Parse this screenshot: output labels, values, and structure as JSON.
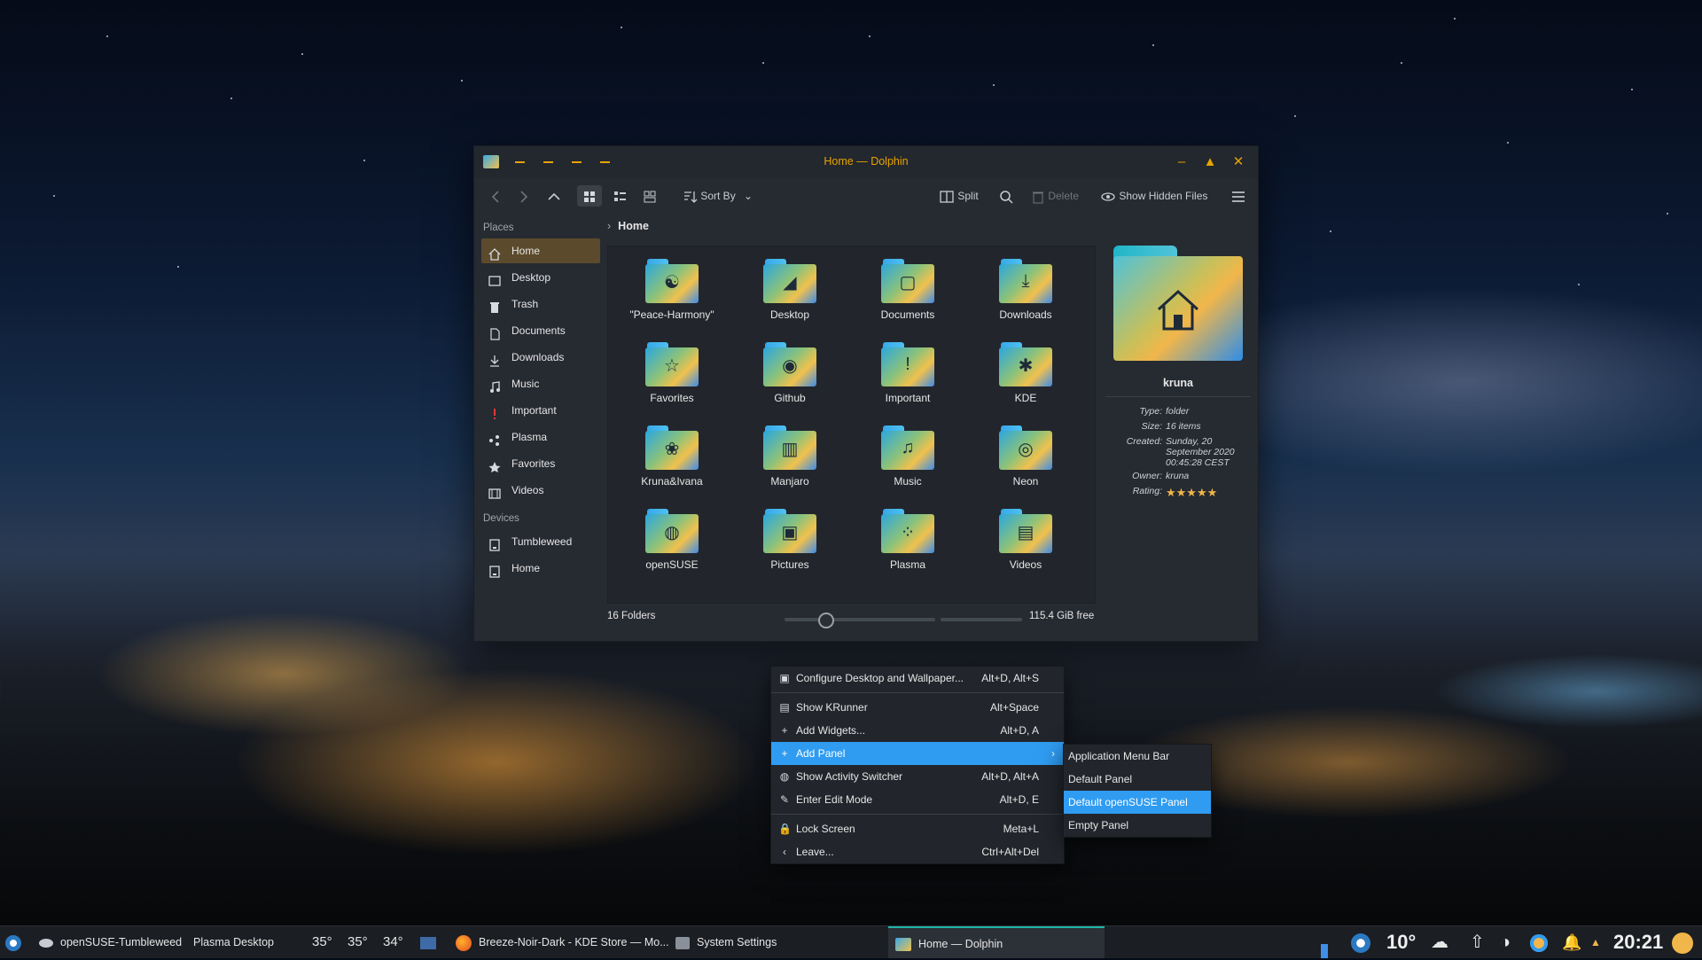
{
  "window": {
    "title": "Home — Dolphin",
    "toolbar": {
      "sort_label": "Sort By",
      "split_label": "Split",
      "delete_label": "Delete",
      "hidden_files_label": "Show Hidden Files"
    },
    "breadcrumb": "Home",
    "places_header": "Places",
    "places": [
      {
        "label": "Home",
        "icon": "home-icon"
      },
      {
        "label": "Desktop",
        "icon": "desktop-icon"
      },
      {
        "label": "Trash",
        "icon": "trash-icon"
      },
      {
        "label": "Documents",
        "icon": "documents-icon"
      },
      {
        "label": "Downloads",
        "icon": "downloads-icon"
      },
      {
        "label": "Music",
        "icon": "music-icon"
      },
      {
        "label": "Important",
        "icon": "important-icon"
      },
      {
        "label": "Plasma",
        "icon": "plasma-icon"
      },
      {
        "label": "Favorites",
        "icon": "star-icon"
      },
      {
        "label": "Videos",
        "icon": "videos-icon"
      }
    ],
    "devices_header": "Devices",
    "devices": [
      {
        "label": "Tumbleweed",
        "icon": "drive-icon"
      },
      {
        "label": "Home",
        "icon": "drive-icon"
      }
    ],
    "files": [
      {
        "label": "\"Peace-Harmony\"",
        "glyph": "☯"
      },
      {
        "label": "Desktop",
        "glyph": "◢"
      },
      {
        "label": "Documents",
        "glyph": "▢"
      },
      {
        "label": "Downloads",
        "glyph": "⤓"
      },
      {
        "label": "Favorites",
        "glyph": "☆"
      },
      {
        "label": "Github",
        "glyph": "◉"
      },
      {
        "label": "Important",
        "glyph": "!"
      },
      {
        "label": "KDE",
        "glyph": "✱"
      },
      {
        "label": "Kruna&Ivana",
        "glyph": "❀"
      },
      {
        "label": "Manjaro",
        "glyph": "▥"
      },
      {
        "label": "Music",
        "glyph": "♫"
      },
      {
        "label": "Neon",
        "glyph": "◎"
      },
      {
        "label": "openSUSE",
        "glyph": "◍"
      },
      {
        "label": "Pictures",
        "glyph": "▣"
      },
      {
        "label": "Plasma",
        "glyph": "⁘"
      },
      {
        "label": "Videos",
        "glyph": "▤"
      }
    ],
    "status": {
      "folders": "16 Folders",
      "free": "115.4 GiB free"
    },
    "info": {
      "name": "kruna",
      "rows": [
        {
          "k": "Type:",
          "v": "folder"
        },
        {
          "k": "Size:",
          "v": "16 items"
        },
        {
          "k": "Created:",
          "v": "Sunday, 20 September 2020 00:45:28 CEST"
        },
        {
          "k": "Owner:",
          "v": "kruna"
        },
        {
          "k": "Rating:",
          "v": "★★★★★"
        }
      ]
    }
  },
  "context_menu": {
    "items": [
      {
        "label": "Configure Desktop and Wallpaper...",
        "shortcut": "Alt+D, Alt+S",
        "icon": "configure-icon"
      },
      {
        "label": "Show KRunner",
        "shortcut": "Alt+Space",
        "icon": "krunner-icon"
      },
      {
        "label": "Add Widgets...",
        "shortcut": "Alt+D, A",
        "icon": "plus-icon"
      },
      {
        "label": "Add Panel",
        "shortcut": "",
        "icon": "plus-icon"
      },
      {
        "label": "Show Activity Switcher",
        "shortcut": "Alt+D, Alt+A",
        "icon": "activity-icon"
      },
      {
        "label": "Enter Edit Mode",
        "shortcut": "Alt+D, E",
        "icon": "edit-icon"
      },
      {
        "label": "Lock Screen",
        "shortcut": "Meta+L",
        "icon": "lock-icon"
      },
      {
        "label": "Leave...",
        "shortcut": "Ctrl+Alt+Del",
        "icon": "leave-icon"
      }
    ],
    "submenu": [
      "Application Menu Bar",
      "Default Panel",
      "Default openSUSE Panel",
      "Empty Panel"
    ]
  },
  "taskbar": {
    "activity": "openSUSE-Tumbleweed",
    "desktop": "Plasma Desktop",
    "temps": [
      "35°",
      "35°",
      "34°"
    ],
    "tasks": [
      "Breeze-Noir-Dark - KDE Store — Mo...",
      "System Settings",
      "Home — Dolphin"
    ],
    "weather": "10°",
    "clock": "20:21"
  },
  "colors": {
    "accent": "#e6a300",
    "highlight": "#2f9cf2",
    "window_bg": "#262a31",
    "taskbar_bg": "#1b1e23"
  }
}
